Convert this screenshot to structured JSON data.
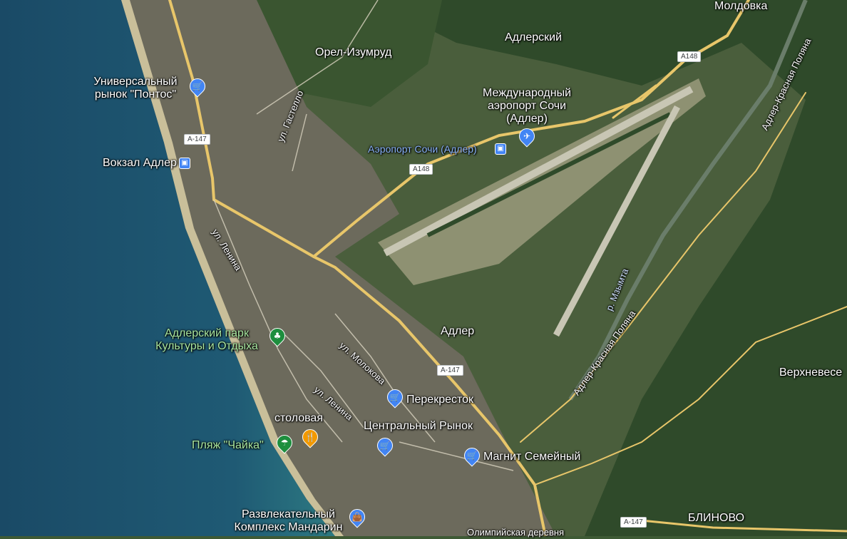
{
  "map": {
    "places": {
      "moldovka": "Молдовка",
      "adlersky": "Адлерский",
      "orel_izumrud": "Орел-Изумруд",
      "adler": "Адлер",
      "verkhneveselo": "Верхневесе",
      "blinovo": "БЛИНОВО",
      "olympic_village": "Олимпийская деревня"
    },
    "pois": {
      "pontos_market": "Универсальный рынок \"Понтос\"",
      "adler_station": "Вокзал Адлер",
      "airport": "Международный аэропорт Сочи (Адлер)",
      "airport_station": "Аэропорт Сочи (Адлер)",
      "adler_park": "Адлерский парк Культуры и Отдыха",
      "perekrestok": "Перекресток",
      "stolovaya": "столовая",
      "central_market": "Центральный Рынок",
      "chaika_beach": "Пляж \"Чайка\"",
      "magnit": "Магнит Семейный",
      "mandarin": "Развлекательный Комплекс Мандарин"
    },
    "streets": {
      "gastello": "ул. Гастелло",
      "lenina_1": "ул. Ленина",
      "lenina_2": "ул. Ленина",
      "molokova": "ул. Молокова",
      "mzymta": "р. Мзымта",
      "adler_krasnaya_1": "Адлер-Красная Поляна",
      "adler_krasnaya_2": "Адлер-Красная Поляна"
    },
    "shields": {
      "a147_1": "А-147",
      "a147_2": "А-147",
      "a147_3": "А-147",
      "a148_1": "А148",
      "a148_2": "А148"
    },
    "colors": {
      "sea": "#1d4f6e",
      "land": "#3e5a35",
      "road": "#e8c66a",
      "shopping_pin": "#4285f4",
      "park_pin": "#1e8e3e",
      "food_pin": "#f29900"
    },
    "icons": {
      "pontos_market": "shopping-cart-icon",
      "adler_station": "train-icon",
      "airport": "airplane-icon",
      "airport_station": "train-icon",
      "adler_park": "park-icon",
      "perekrestok": "shopping-cart-icon",
      "central_market": "shopping-cart-icon",
      "chaika_beach": "beach-icon",
      "stolovaya": "fork-knife-icon",
      "magnit": "shopping-cart-icon",
      "mandarin": "shopping-bag-icon"
    }
  }
}
